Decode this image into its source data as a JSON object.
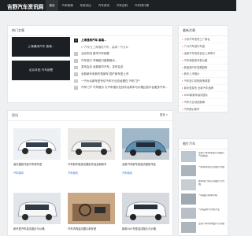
{
  "site": {
    "logo": "吉野汽车资讯网"
  },
  "nav": [
    "首页",
    "汽车新闻",
    "车型对比",
    "汽车资讯",
    "汽车百科",
    "汽车排行榜"
  ],
  "hot": {
    "title": "热门文章",
    "features": [
      "上海通用汽车 高端...",
      "北京本田 汽车销售"
    ],
    "items": [
      "上海通用汽车 高端...",
      "1~汽车业上海通用汽车，高端一汽大众",
      "北京本田 豪华汽车销售",
      "汽车进口 车辆进口趋势报价...",
      "发布会总 全新新华汽车，发布会总",
      "全新新车系新车型新车 国产新车型上市",
      "一汽大众新车型专访汽车行业总经理在 汽车门户",
      "汽车门户 汽车报价 与汽车报价在线平台新车与价格比较平台更多汽车..."
    ]
  },
  "news": {
    "title": "资讯",
    "more": "更多 »",
    "items": [
      {
        "title": "高清摄影作品汽车新车型",
        "tag": "汽车新闻"
      },
      {
        "title": "汽车新车型高清摄影作品全新新车",
        "tag": "汽车新闻"
      },
      {
        "title": "全新汽车新车型高清摄影作品",
        "tag": "汽车新闻"
      },
      {
        "title": "新车型汽车高清图片与价格",
        "tag": "汽车新闻"
      },
      {
        "title": "汽车内饰高清图片新车型",
        "tag": "汽车新闻"
      },
      {
        "title": "新款SUV车型高清图片与价格",
        "tag": "汽车新闻"
      }
    ]
  },
  "latest": {
    "title": "最新文章",
    "items": [
      "小米汽车发布工厂新址",
      "广州汽车进口车型",
      "全新汽车发布会在上海举行",
      "汽车销售新车型价格",
      "新能源汽车发展趋势",
      "新车上市报价",
      "汽车进口关税政策调整",
      "新车型发布 全新汽车品牌",
      "2000款新车高清图片",
      "汽车行业动态新闻",
      "汽车报价新车"
    ]
  },
  "pics": {
    "title": "图片汽车",
    "items": [
      "全新汽车新车型高清图片汽车新车",
      "汽车新车型高清图片价格",
      "新车型汽车高清图片与价格",
      "汽车图片新车价格",
      "汽车品牌与价格大全",
      "全新汽车内饰图片与价格"
    ]
  },
  "colors": {
    "header": "#1d2124",
    "accent": "#2a7ae2",
    "background": "#eef0f2"
  }
}
